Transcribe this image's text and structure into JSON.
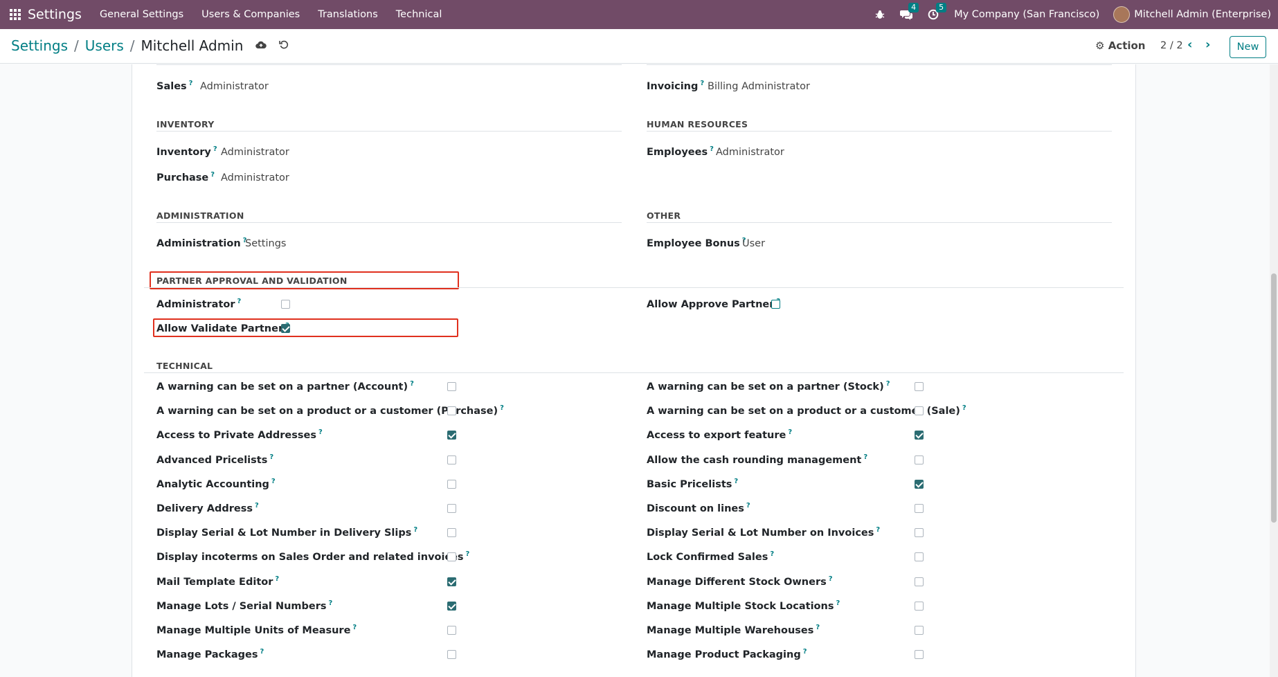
{
  "navbar": {
    "brand": "Settings",
    "menu": [
      "General Settings",
      "Users & Companies",
      "Translations",
      "Technical"
    ],
    "messages_count": "4",
    "activities_count": "5",
    "company": "My Company (San Francisco)",
    "user": "Mitchell Admin (Enterprise)"
  },
  "control": {
    "breadcrumb": [
      "Settings",
      "Users",
      "Mitchell Admin"
    ],
    "action_label": "Action",
    "pager": "2 / 2",
    "new_label": "New"
  },
  "top_fields": {
    "sales": {
      "label": "Sales",
      "value": "Administrator"
    },
    "invoicing": {
      "label": "Invoicing",
      "value": "Billing Administrator"
    }
  },
  "sections": {
    "inventory": {
      "title": "INVENTORY",
      "fields": [
        {
          "label": "Inventory",
          "value": "Administrator"
        },
        {
          "label": "Purchase",
          "value": "Administrator"
        }
      ]
    },
    "human_resources": {
      "title": "HUMAN RESOURCES",
      "fields": [
        {
          "label": "Employees",
          "value": "Administrator"
        }
      ]
    },
    "administration": {
      "title": "ADMINISTRATION",
      "fields": [
        {
          "label": "Administration",
          "value": "Settings"
        }
      ]
    },
    "other": {
      "title": "OTHER",
      "fields": [
        {
          "label": "Employee Bonus",
          "value": "User"
        }
      ]
    },
    "partner": {
      "title": "PARTNER APPROVAL AND VALIDATION",
      "fields": [
        {
          "label": "Administrator",
          "checked": false
        },
        {
          "label": "Allow Validate Partner",
          "checked": true
        },
        {
          "label": "Allow Approve Partner",
          "checked": false
        }
      ]
    },
    "technical": {
      "title": "TECHNICAL",
      "left": [
        {
          "label": "A warning can be set on a partner (Account)",
          "checked": false
        },
        {
          "label": "A warning can be set on a product or a customer (Purchase)",
          "checked": false
        },
        {
          "label": "Access to Private Addresses",
          "checked": true
        },
        {
          "label": "Advanced Pricelists",
          "checked": false
        },
        {
          "label": "Analytic Accounting",
          "checked": false
        },
        {
          "label": "Delivery Address",
          "checked": false
        },
        {
          "label": "Display Serial & Lot Number in Delivery Slips",
          "checked": false
        },
        {
          "label": "Display incoterms on Sales Order and related invoices",
          "checked": false
        },
        {
          "label": "Mail Template Editor",
          "checked": true
        },
        {
          "label": "Manage Lots / Serial Numbers",
          "checked": true
        },
        {
          "label": "Manage Multiple Units of Measure",
          "checked": false
        },
        {
          "label": "Manage Packages",
          "checked": false
        }
      ],
      "right": [
        {
          "label": "A warning can be set on a partner (Stock)",
          "checked": false
        },
        {
          "label": "A warning can be set on a product or a customer (Sale)",
          "checked": false
        },
        {
          "label": "Access to export feature",
          "checked": true
        },
        {
          "label": "Allow the cash rounding management",
          "checked": false
        },
        {
          "label": "Basic Pricelists",
          "checked": true
        },
        {
          "label": "Discount on lines",
          "checked": false
        },
        {
          "label": "Display Serial & Lot Number on Invoices",
          "checked": false
        },
        {
          "label": "Lock Confirmed Sales",
          "checked": false
        },
        {
          "label": "Manage Different Stock Owners",
          "checked": false
        },
        {
          "label": "Manage Multiple Stock Locations",
          "checked": false
        },
        {
          "label": "Manage Multiple Warehouses",
          "checked": false
        },
        {
          "label": "Manage Product Packaging",
          "checked": false
        }
      ]
    }
  },
  "help_mark": "?"
}
